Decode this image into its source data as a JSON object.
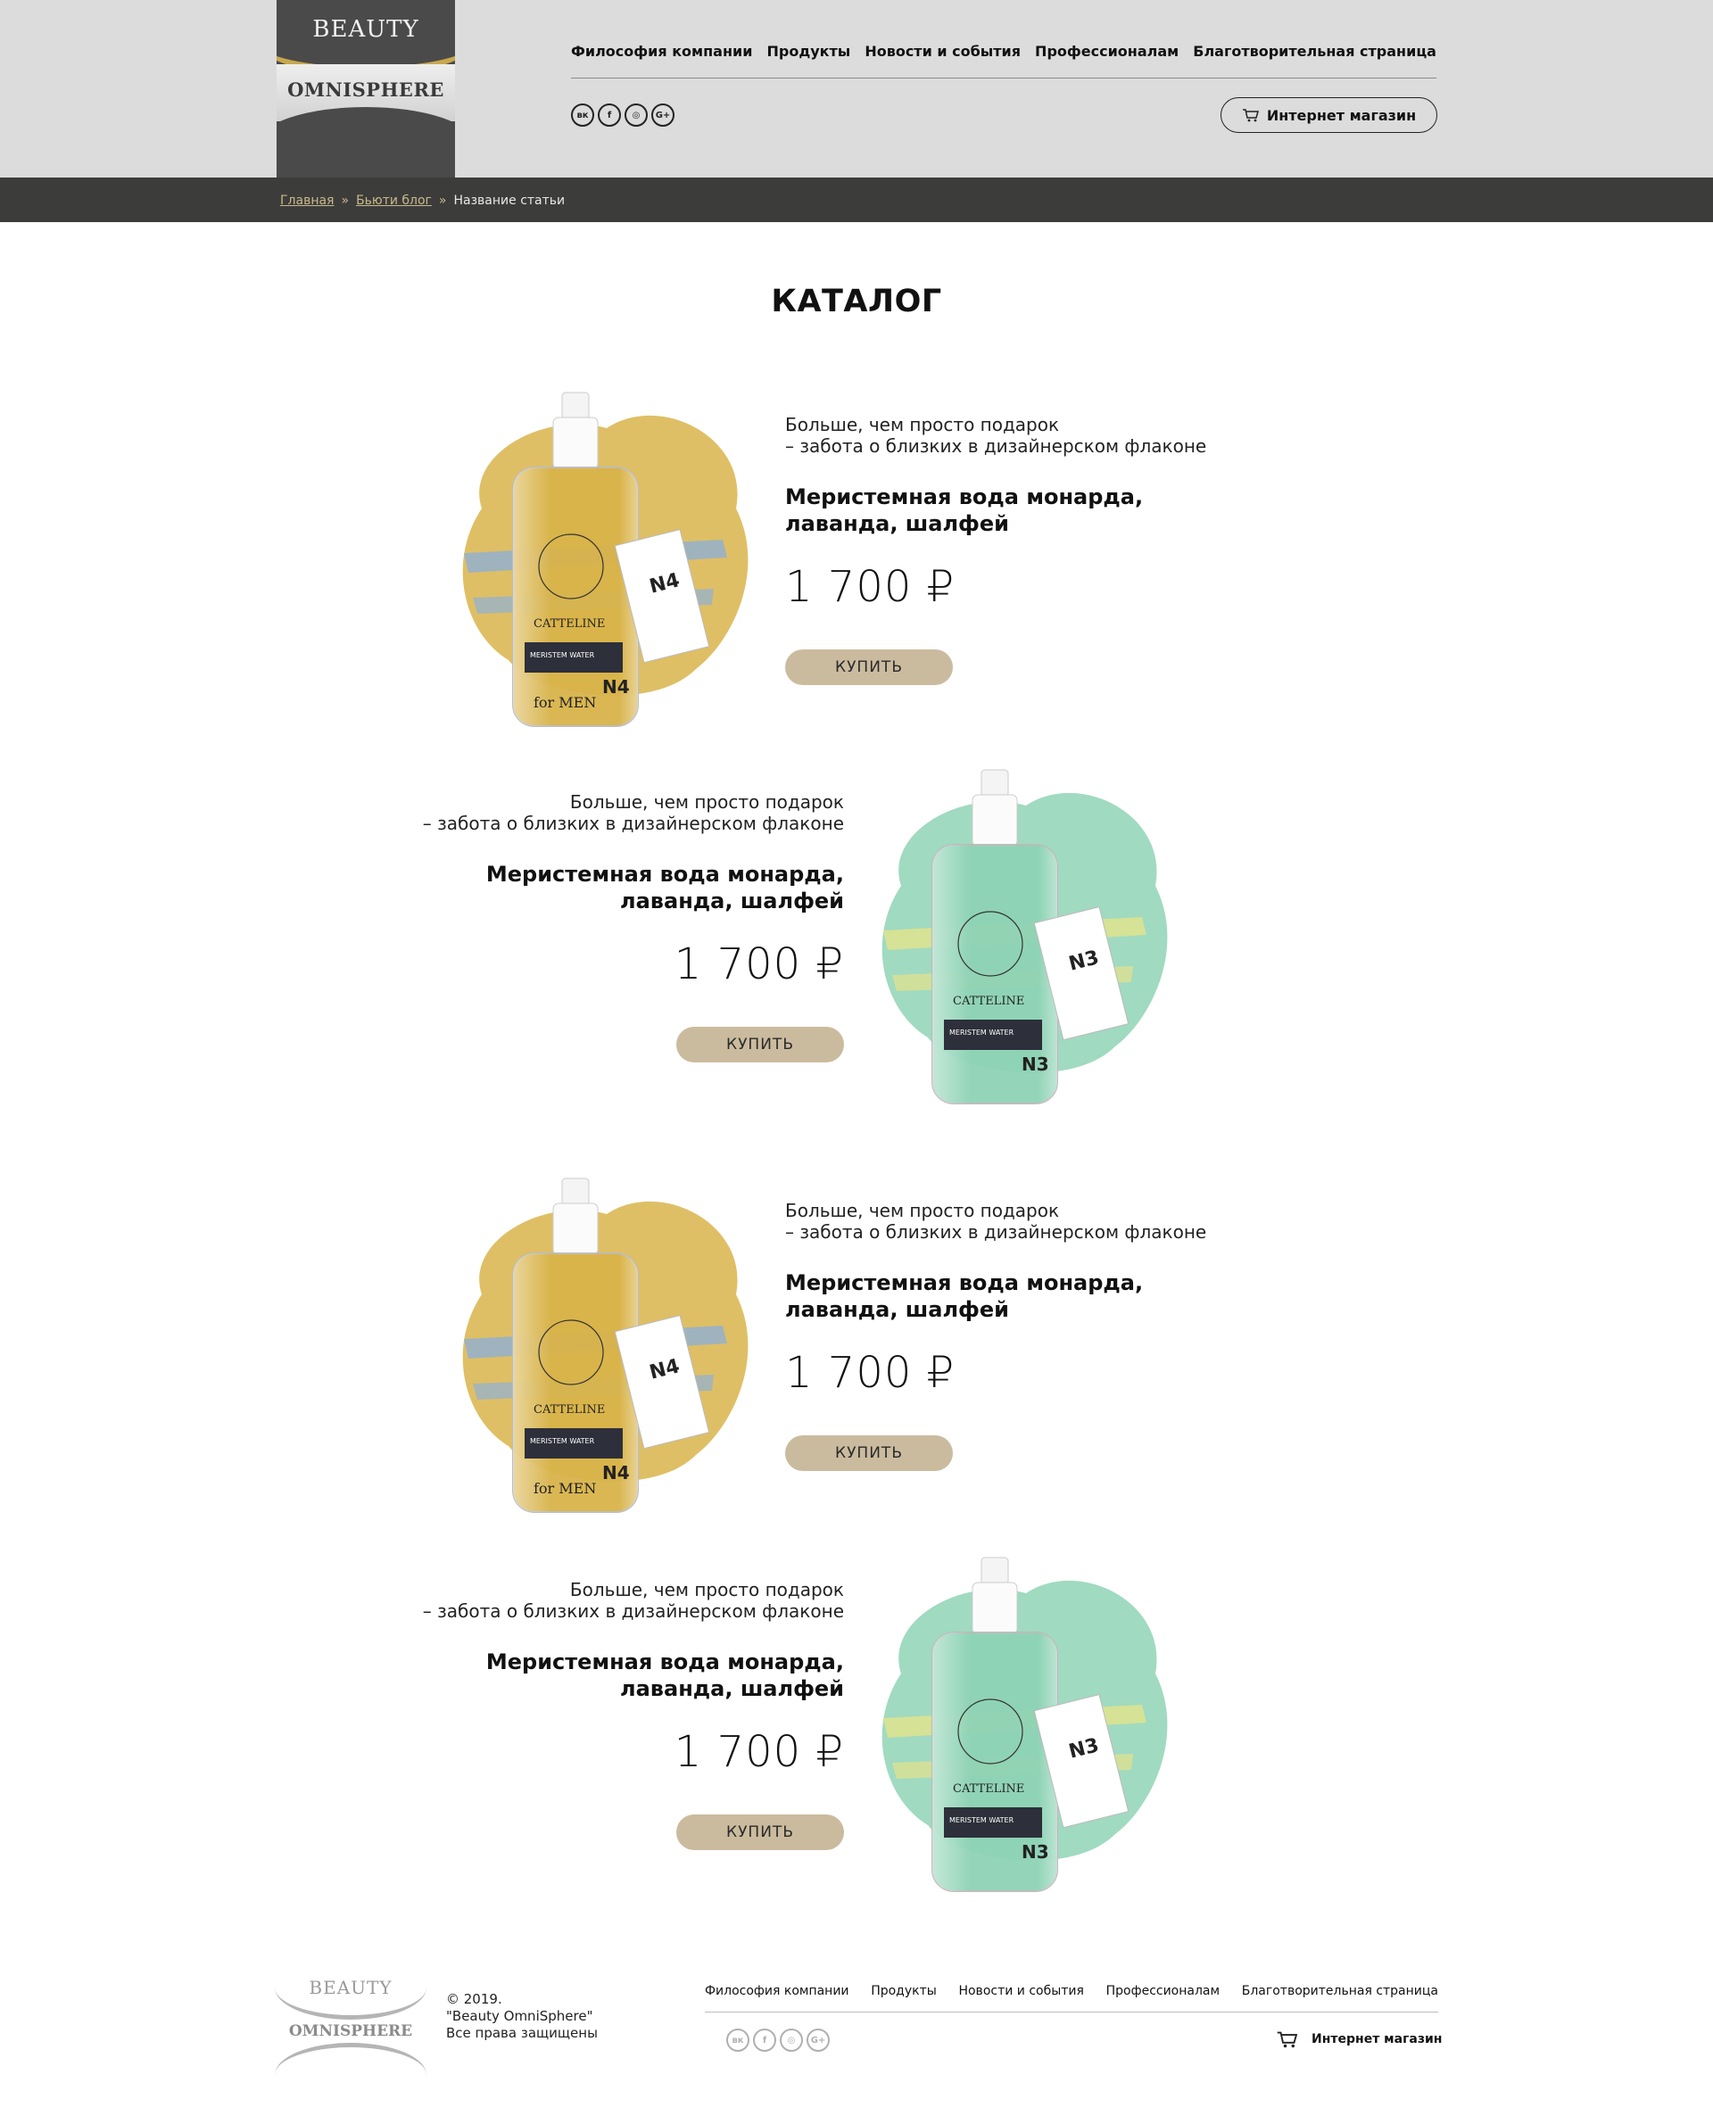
{
  "header": {
    "logo_top": "BEAUTY",
    "logo_bottom": "OMNISPHERE",
    "nav": [
      "Философия компании",
      "Продукты",
      "Новости и события",
      "Профессионалам",
      "Благотворительная страница"
    ],
    "socials": [
      "vk-icon",
      "facebook-icon",
      "instagram-icon",
      "google-plus-icon"
    ],
    "social_glyphs": [
      "вк",
      "f",
      "◎",
      "G+"
    ],
    "shop_label": "Интернет магазин"
  },
  "breadcrumb": {
    "home": "Главная",
    "sep": "»",
    "blog": "Бьюти блог",
    "current": "Название статьи"
  },
  "catalog": {
    "title": "КАТАЛОГ",
    "products": [
      {
        "subtitle_1": "Больше, чем просто подарок",
        "subtitle_2": "– забота о близких в дизайнерском флаконе",
        "name_1": "Меристемная вода монарда,",
        "name_2": "лаванда, шалфей",
        "price": "1 700 ₽",
        "buy": "КУПИТЬ",
        "label_num": "N4",
        "label_extra": "for MEN",
        "brand": "CATTELINE",
        "water": "MERISTEM WATER",
        "accent": "#d9b44a",
        "accent2": "#8fb0d6"
      },
      {
        "subtitle_1": "Больше, чем просто подарок",
        "subtitle_2": "– забота о близких в дизайнерском флаконе",
        "name_1": "Меристемная вода монарда,",
        "name_2": "лаванда, шалфей",
        "price": "1 700 ₽",
        "buy": "КУПИТЬ",
        "label_num": "N3",
        "label_extra": "",
        "brand": "CATTELINE",
        "water": "MERISTEM WATER",
        "accent": "#8fd3b6",
        "accent2": "#e4e38a"
      },
      {
        "subtitle_1": "Больше, чем просто подарок",
        "subtitle_2": "– забота о близких в дизайнерском флаконе",
        "name_1": "Меристемная вода монарда,",
        "name_2": "лаванда, шалфей",
        "price": "1 700 ₽",
        "buy": "КУПИТЬ",
        "label_num": "N4",
        "label_extra": "for MEN",
        "brand": "CATTELINE",
        "water": "MERISTEM WATER",
        "accent": "#d9b44a",
        "accent2": "#8fb0d6"
      },
      {
        "subtitle_1": "Больше, чем просто подарок",
        "subtitle_2": "– забота о близких в дизайнерском флаконе",
        "name_1": "Меристемная вода монарда,",
        "name_2": "лаванда, шалфей",
        "price": "1 700 ₽",
        "buy": "КУПИТЬ",
        "label_num": "N3",
        "label_extra": "",
        "brand": "CATTELINE",
        "water": "MERISTEM WATER",
        "accent": "#8fd3b6",
        "accent2": "#e4e38a"
      }
    ]
  },
  "footer": {
    "logo_top": "BEAUTY",
    "logo_bottom": "OMNISPHERE",
    "copy_1": "© 2019.",
    "copy_2": "\"Beauty OmniSphere\"",
    "copy_3": "Все права защищены",
    "nav": [
      "Философия компании",
      "Продукты",
      "Новости и события",
      "Профессионалам",
      "Благотворительная страница"
    ],
    "shop_label": "Интернет магазин"
  },
  "colors": {
    "header_bg": "#dcdcdc",
    "crumb_bg": "#3c3c3a",
    "button_bg": "#cbbb9e",
    "logo_gold": "#c8a84e"
  }
}
